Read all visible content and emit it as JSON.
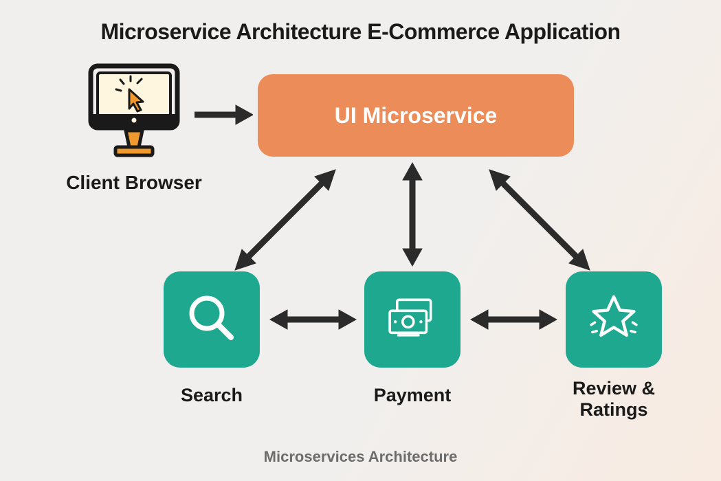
{
  "title": "Microservice Architecture E-Commerce Application",
  "caption": "Microservices Architecture",
  "client_label": "Client Browser",
  "ui_microservice_label": "UI Microservice",
  "services": {
    "search": {
      "label": "Search"
    },
    "payment": {
      "label": "Payment"
    },
    "review": {
      "label": "Review &\nRatings"
    }
  },
  "colors": {
    "ui_box": "#ec8c58",
    "service_box": "#1ea88f",
    "arrow": "#2b2b2b"
  }
}
